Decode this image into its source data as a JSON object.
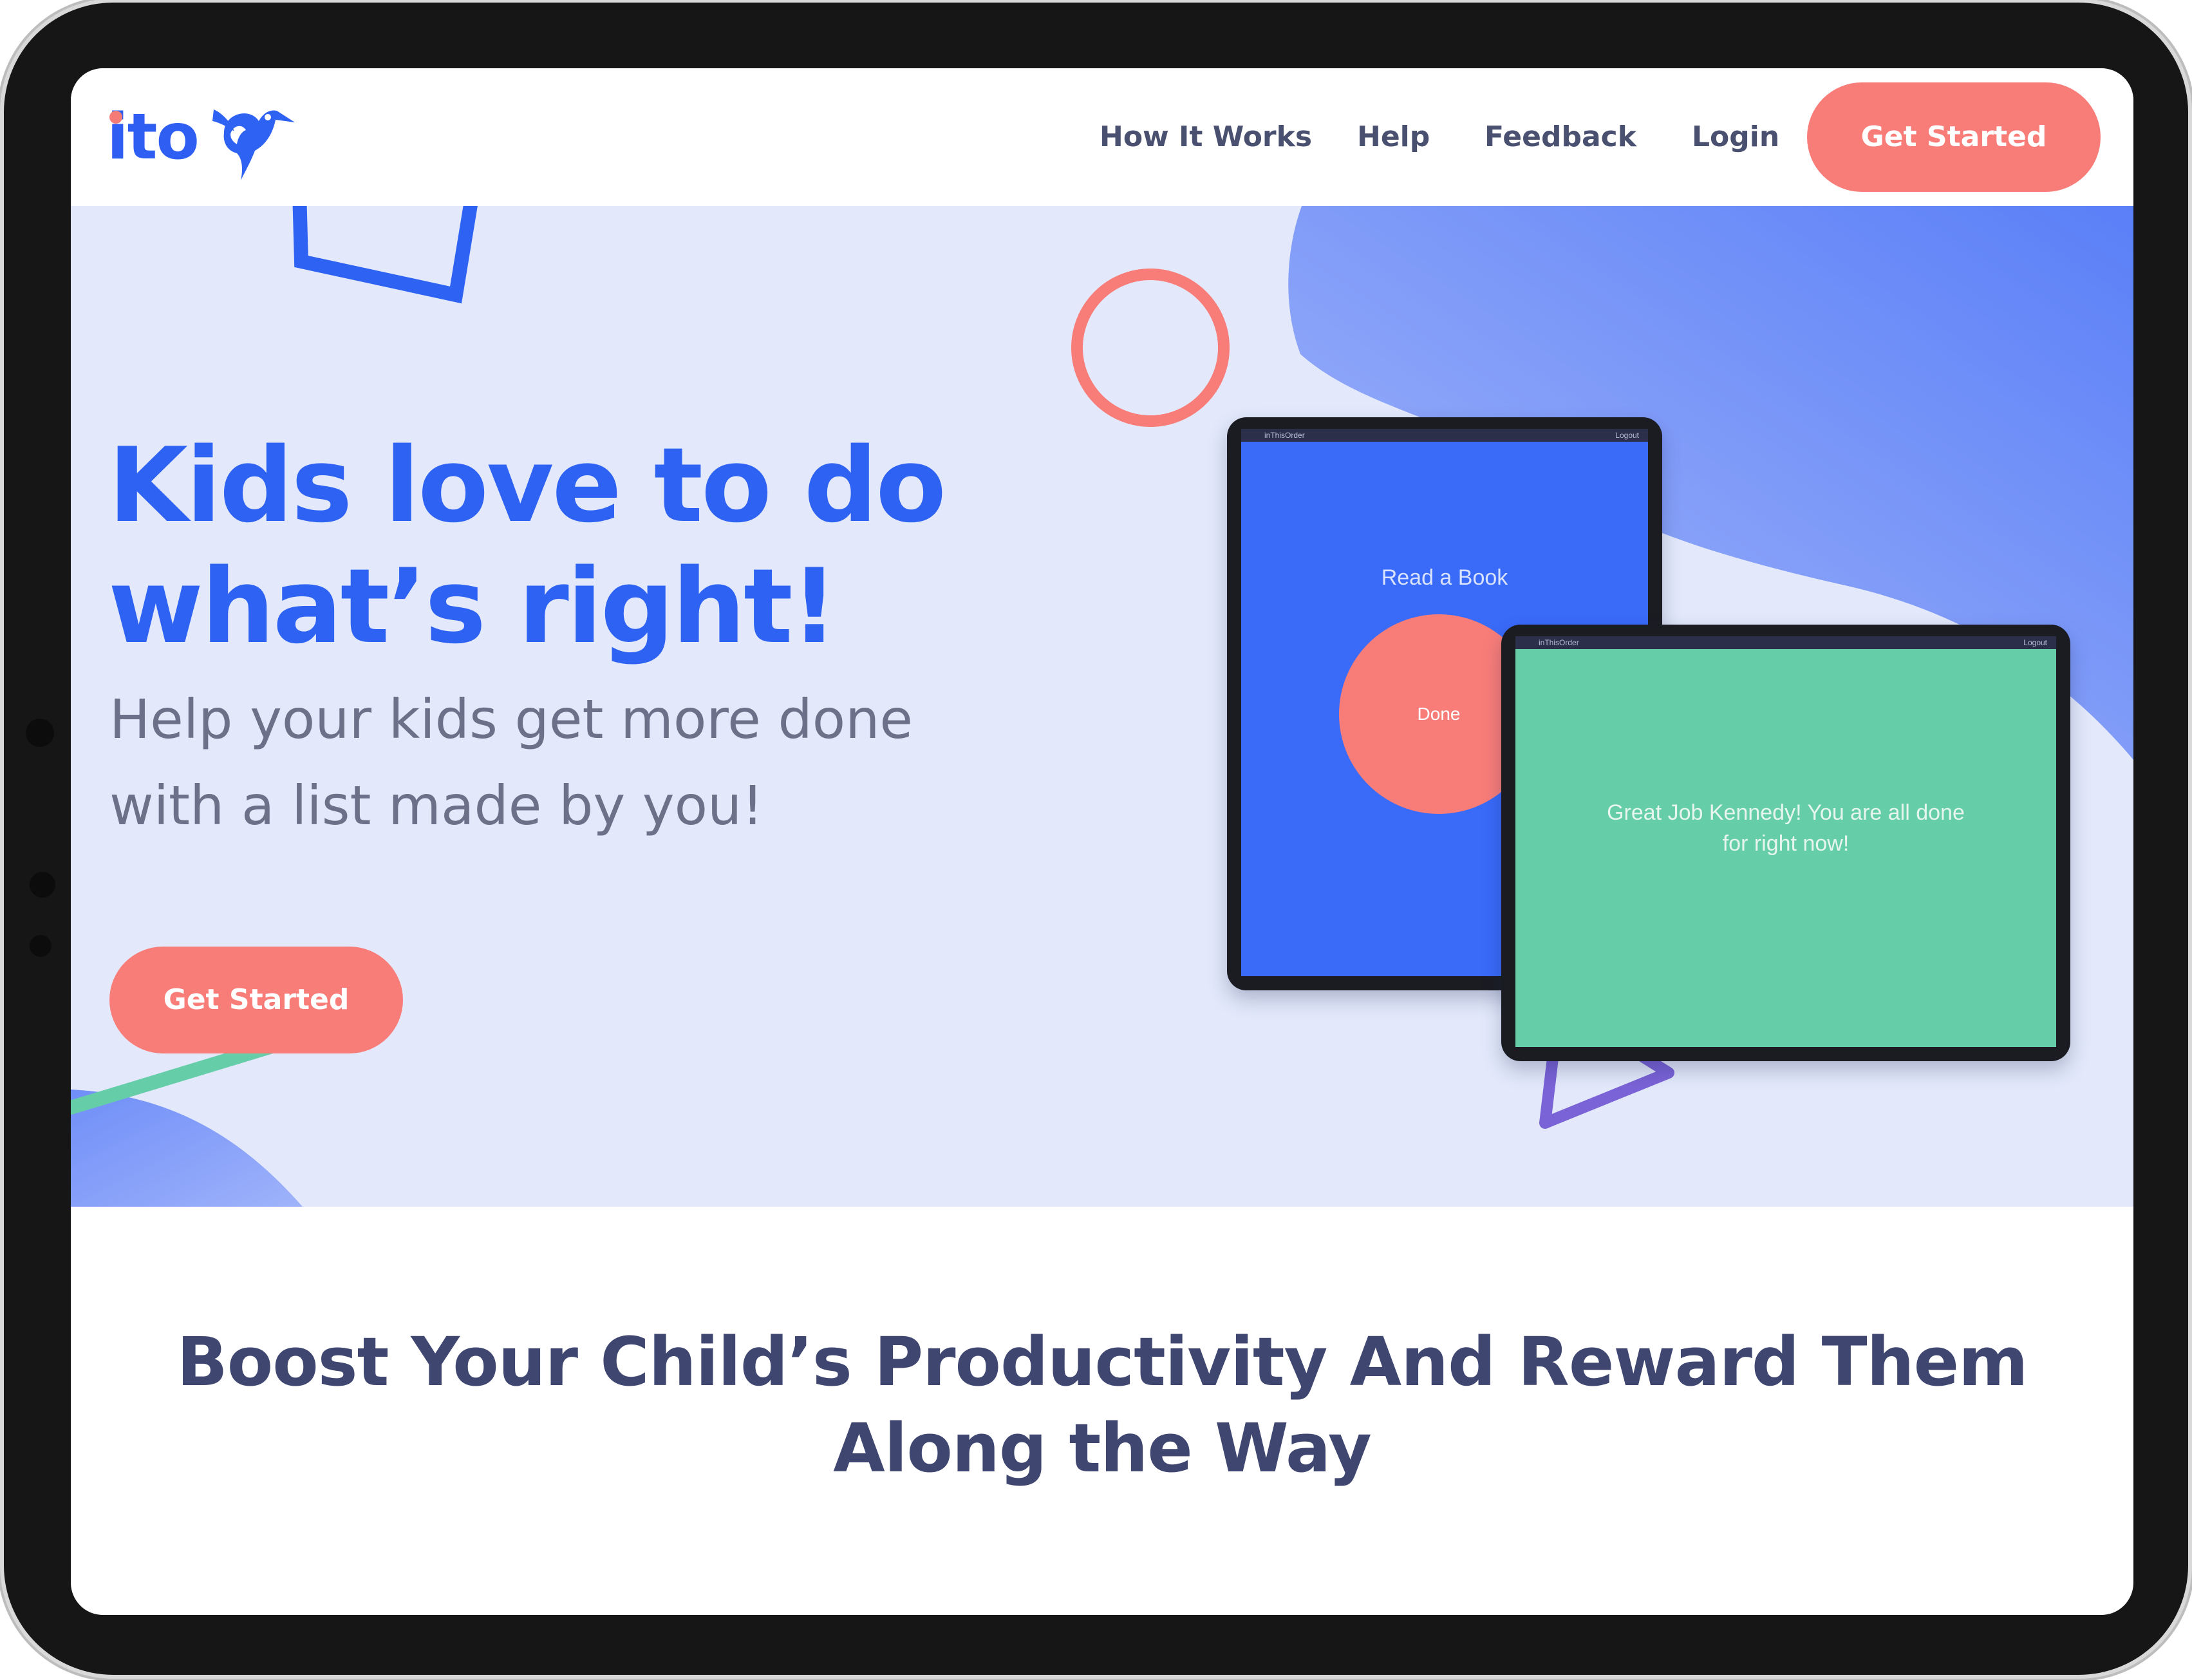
{
  "brand": {
    "name": "ito",
    "primary_color": "#2e62f2",
    "accent_color": "#f87d79",
    "green_color": "#66cda9"
  },
  "nav": {
    "links": [
      {
        "label": "How It Works"
      },
      {
        "label": "Help"
      },
      {
        "label": "Feedback"
      },
      {
        "label": "Login"
      }
    ],
    "cta_label": "Get Started"
  },
  "hero": {
    "title_line1": "Kids love to do",
    "title_line2": "what’s right!",
    "subtitle_line1": "Help your kids get more done",
    "subtitle_line2": "with a list made by you!",
    "cta_label": "Get Started"
  },
  "tablet_task": {
    "app_label": "inThisOrder",
    "logout_label": "Logout",
    "task_title": "Read a Book",
    "done_label": "Done"
  },
  "tablet_done": {
    "app_label": "inThisOrder",
    "logout_label": "Logout",
    "message_line1": "Great Job Kennedy! You are all done",
    "message_line2": "for right now!"
  },
  "section": {
    "title_line1": "Boost Your Child’s Productivity And Reward Them",
    "title_line2": "Along the Way"
  }
}
